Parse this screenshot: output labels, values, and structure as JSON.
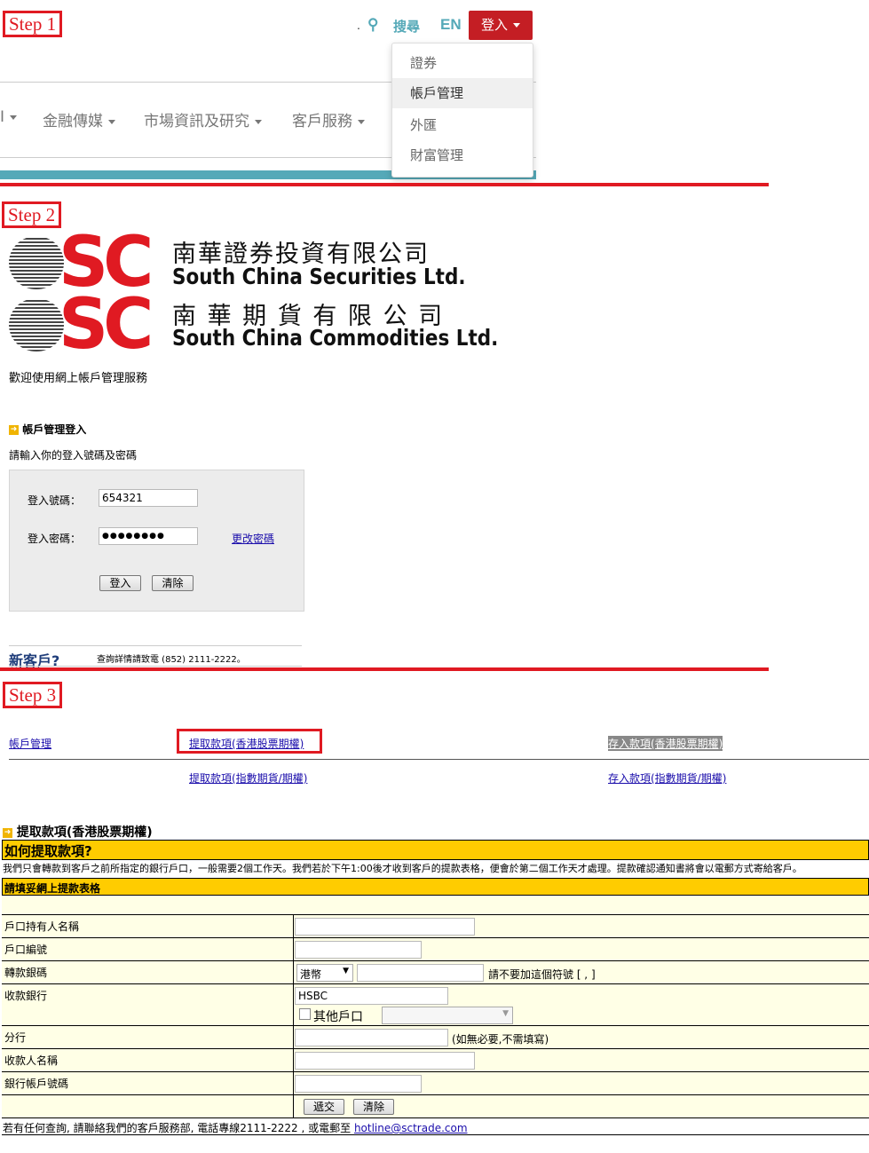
{
  "step_labels": {
    "s1": "Step 1",
    "s2": "Step 2",
    "s3": "Step 3"
  },
  "header": {
    "dot": ".",
    "search_label": "搜尋",
    "lang": "EN",
    "login_label": "登入",
    "dropdown": [
      "證券",
      "帳戶管理",
      "外匯",
      "財富管理"
    ],
    "menu": [
      "金融傳媒",
      "市場資訊及研究",
      "客戶服務"
    ]
  },
  "logo": {
    "sc": "SC",
    "cn1": "南華證券投資有限公司",
    "en1": "South China Securities Ltd.",
    "cn2": "南 華 期 貨 有 限 公 司",
    "en2": "South China Commodities Ltd."
  },
  "login": {
    "welcome": "歡迎使用網上帳戶管理服務",
    "section_title": "帳戶管理登入",
    "instruction": "請輸入你的登入號碼及密碼",
    "id_label": "登入號碼：",
    "id_value": "654321",
    "pw_label": "登入密碼：",
    "pw_value": "●●●●●●●●",
    "change_pw": "更改密碼",
    "submit": "登入",
    "clear": "清除",
    "new_client": "新客戶?",
    "enquiry": "查詢詳情請致電 (852) 2111-2222。"
  },
  "tabs": {
    "account": "帳戶管理",
    "withdraw_hk": "提取款項(香港股票期權)",
    "deposit_hk": "存入款項(香港股票期權)",
    "withdraw_idx": "提取款項(指數期貨/期權)",
    "deposit_idx": "存入款項(指數期貨/期權)"
  },
  "withdraw": {
    "title": "提取款項(香港股票期權)",
    "how_title": "如何提取款項?",
    "how_text": "我們只會轉款到客戶之前所指定的銀行戶口，一般需要2個工作天。我們若於下午1:00後才收到客戶的提款表格，便會於第二個工作天才處理。提款確認通知書將會以電郵方式寄給客戶。",
    "form_title": "請填妥網上提款表格",
    "fields": {
      "holder": "戶口持有人名稱",
      "acct_no": "戶口編號",
      "amount": "轉款銀碼",
      "currency": "港幣",
      "amount_note": "請不要加這個符號 [ , ]",
      "bank": "收款銀行",
      "bank_value": "HSBC",
      "other_acct": "其他戶口",
      "branch": "分行",
      "branch_note": "(如無必要,不需填寫)",
      "payee": "收款人名稱",
      "bank_acct": "銀行帳戶號碼"
    },
    "submit": "遞交",
    "clear": "清除",
    "footer_text": "若有任何查詢, 請聯絡我們的客戶服務部, 電話專線2111-2222 , 或電郵至 ",
    "footer_email": "hotline@sctrade.com"
  }
}
